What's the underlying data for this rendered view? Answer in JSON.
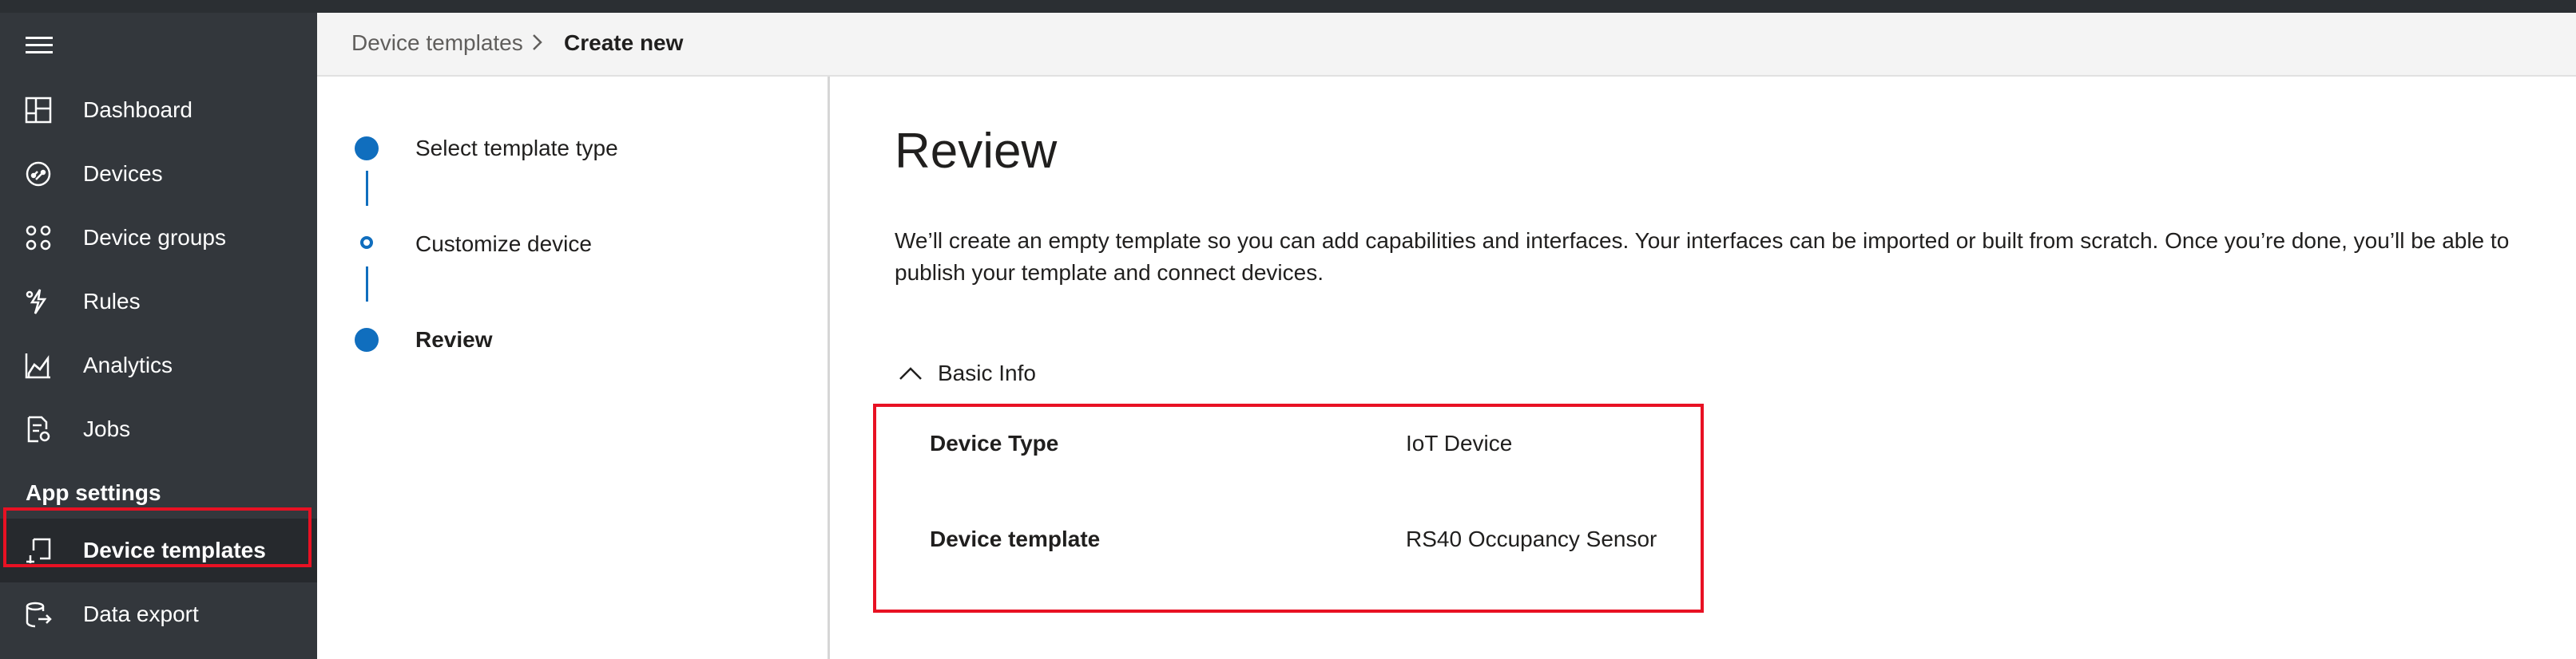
{
  "sidebar": {
    "items": [
      {
        "label": "Dashboard",
        "icon": "dashboard-icon"
      },
      {
        "label": "Devices",
        "icon": "devices-icon"
      },
      {
        "label": "Device groups",
        "icon": "device-groups-icon"
      },
      {
        "label": "Rules",
        "icon": "rules-icon"
      },
      {
        "label": "Analytics",
        "icon": "analytics-icon"
      },
      {
        "label": "Jobs",
        "icon": "jobs-icon"
      }
    ],
    "section_label": "App settings",
    "settings_items": [
      {
        "label": "Device templates",
        "icon": "device-templates-icon",
        "active": true
      },
      {
        "label": "Data export",
        "icon": "data-export-icon"
      }
    ]
  },
  "breadcrumb": {
    "parent": "Device templates",
    "current": "Create new"
  },
  "steps": [
    {
      "label": "Select template type",
      "state": "complete"
    },
    {
      "label": "Customize device",
      "state": "pending"
    },
    {
      "label": "Review",
      "state": "current"
    }
  ],
  "review": {
    "title": "Review",
    "description": "We’ll create an empty template so you can add capabilities and interfaces. Your interfaces can be imported or built from scratch. Once you’re done, you’ll be able to publish your template and connect devices.",
    "section_title": "Basic Info",
    "rows": [
      {
        "label": "Device Type",
        "value": "IoT Device"
      },
      {
        "label": "Device template",
        "value": "RS40 Occupancy Sensor"
      }
    ]
  },
  "colors": {
    "sidebar_bg": "#33373c",
    "accent": "#106ebe",
    "highlight": "#e81123"
  }
}
